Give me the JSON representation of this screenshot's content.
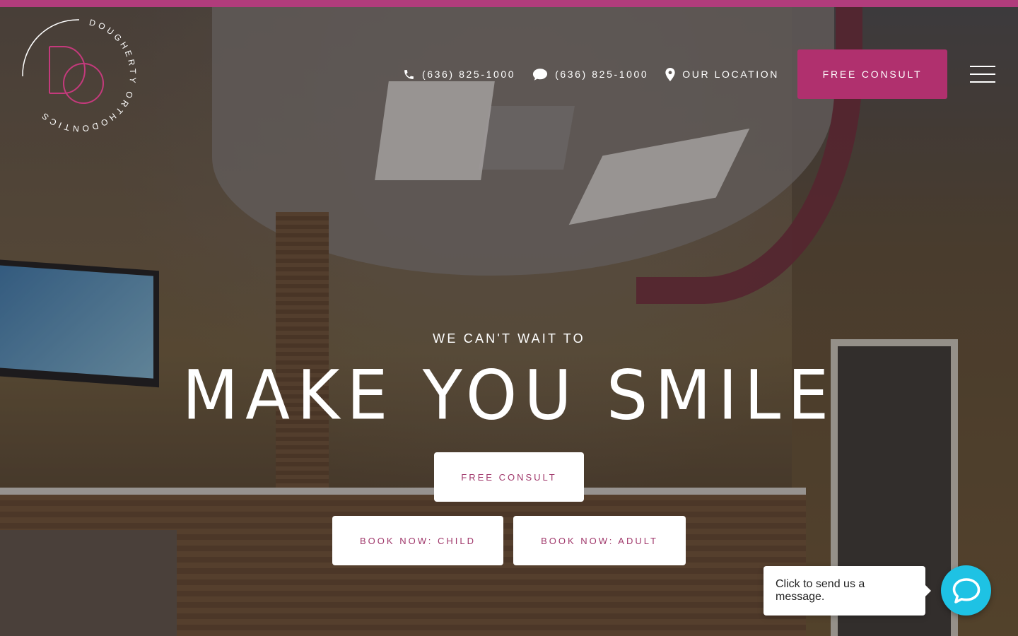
{
  "brand": {
    "name": "DOUGHERTY ORTHODONTICS",
    "monogram": "DO",
    "accent_color": "#b0306e",
    "top_bar_color": "#b13c7c"
  },
  "header": {
    "phone": {
      "icon": "phone-icon",
      "label": "(636) 825-1000"
    },
    "text": {
      "icon": "chat-bubble-icon",
      "label": "(636) 825-1000"
    },
    "location": {
      "icon": "map-pin-icon",
      "label": "OUR LOCATION"
    },
    "consult_label": "FREE CONSULT",
    "menu_icon": "hamburger-menu-icon"
  },
  "hero": {
    "eyebrow": "WE CAN'T WAIT TO",
    "headline": "MAKE YOU SMILE",
    "consult_label": "FREE CONSULT",
    "book_child_label": "BOOK NOW: CHILD",
    "book_adult_label": "BOOK NOW: ADULT"
  },
  "chat": {
    "prompt": "Click to send us a message.",
    "icon": "chat-icon",
    "color": "#1ec2e4"
  }
}
